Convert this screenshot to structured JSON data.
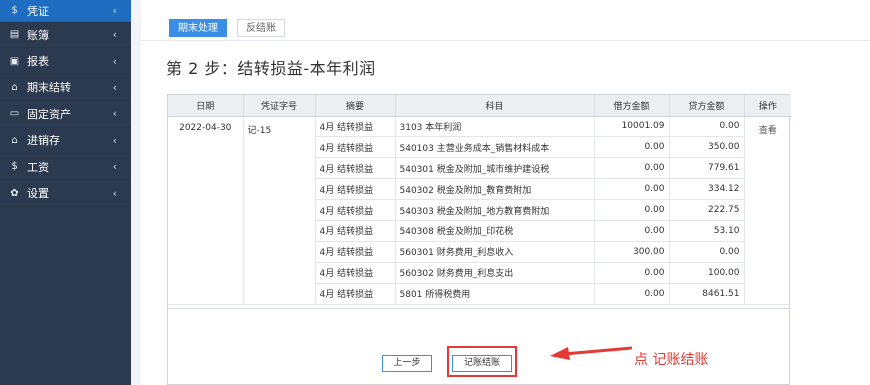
{
  "sidebar": {
    "items": [
      {
        "icon": "$",
        "label": "凭证"
      },
      {
        "icon": "▤",
        "label": "账簿"
      },
      {
        "icon": "▣",
        "label": "报表"
      },
      {
        "icon": "⌂",
        "label": "期末结转"
      },
      {
        "icon": "▭",
        "label": "固定资产"
      },
      {
        "icon": "⌂",
        "label": "进销存"
      },
      {
        "icon": "$",
        "label": "工资"
      },
      {
        "icon": "✿",
        "label": "设置"
      }
    ]
  },
  "tabs": [
    {
      "label": "期末处理"
    },
    {
      "label": "反结账"
    }
  ],
  "page_title": "第 2 步：结转损益-本年利润",
  "table": {
    "headers": [
      "日期",
      "凭证字号",
      "摘要",
      "科目",
      "借方金额",
      "贷方金额",
      "操作"
    ],
    "date": "2022-04-30",
    "voucher_no": "记-15",
    "action": "查看",
    "rows": [
      {
        "summary": "4月 结转损益",
        "account": "3103 本年利润",
        "debit": "10001.09",
        "credit": "0.00"
      },
      {
        "summary": "4月 结转损益",
        "account": "540103 主营业务成本_销售材料成本",
        "debit": "0.00",
        "credit": "350.00"
      },
      {
        "summary": "4月 结转损益",
        "account": "540301 税金及附加_城市维护建设税",
        "debit": "0.00",
        "credit": "779.61"
      },
      {
        "summary": "4月 结转损益",
        "account": "540302 税金及附加_教育费附加",
        "debit": "0.00",
        "credit": "334.12"
      },
      {
        "summary": "4月 结转损益",
        "account": "540303 税金及附加_地方教育费附加",
        "debit": "0.00",
        "credit": "222.75"
      },
      {
        "summary": "4月 结转损益",
        "account": "540308 税金及附加_印花税",
        "debit": "0.00",
        "credit": "53.10"
      },
      {
        "summary": "4月 结转损益",
        "account": "560301 财务费用_利息收入",
        "debit": "300.00",
        "credit": "0.00"
      },
      {
        "summary": "4月 结转损益",
        "account": "560302 财务费用_利息支出",
        "debit": "0.00",
        "credit": "100.00"
      },
      {
        "summary": "4月 结转损益",
        "account": "5801 所得税费用",
        "debit": "0.00",
        "credit": "8461.51"
      }
    ]
  },
  "buttons": {
    "prev": "上一步",
    "post": "记账结账"
  },
  "annotation": "点 记账结账",
  "colors": {
    "sidebar_bg": "#2b3a4e",
    "sidebar_active": "#1f6dc0",
    "accent": "#3a8ee6",
    "annotation_red": "#e53935"
  }
}
